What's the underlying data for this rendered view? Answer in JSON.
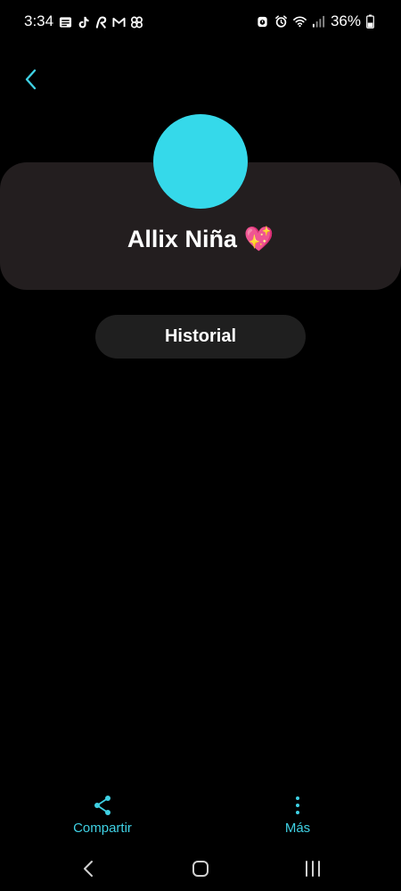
{
  "status_bar": {
    "time": "3:34",
    "battery_percent": "36%",
    "left_icons": [
      "news-icon",
      "tiktok-icon",
      "r-app-icon",
      "gmail-icon",
      "pinwheel-icon"
    ],
    "right_icons": [
      "alarm-clock-icon",
      "alarm-icon",
      "wifi-icon",
      "signal-icon",
      "battery-icon"
    ]
  },
  "contact": {
    "name": "Allix Niña 💖",
    "avatar_color": "#35d9ea"
  },
  "buttons": {
    "history_label": "Historial",
    "share_label": "Compartir",
    "more_label": "Más"
  },
  "colors": {
    "accent": "#3fd1e4",
    "card_background": "#231e1f",
    "pill_background": "#1f1f1f",
    "background": "#000000"
  },
  "icons": {
    "back": "chevron-left-icon",
    "share": "share-icon",
    "more": "more-vertical-icon",
    "nav_back": "nav-back-icon",
    "nav_home": "nav-home-icon",
    "nav_recents": "nav-recents-icon"
  }
}
